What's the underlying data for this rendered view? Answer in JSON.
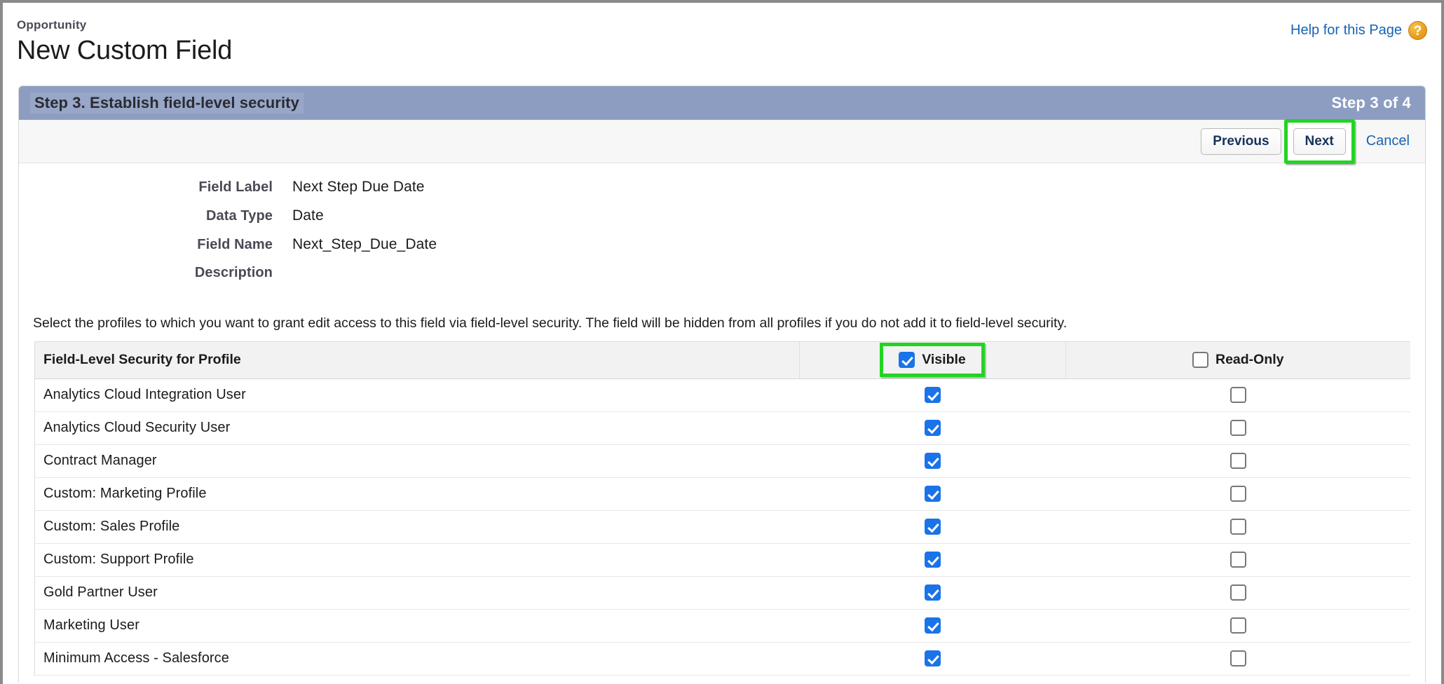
{
  "header": {
    "object": "Opportunity",
    "title": "New Custom Field",
    "help_label": "Help for this Page",
    "help_icon": "question-mark-badge-icon"
  },
  "step_bar": {
    "title": "Step 3. Establish field-level security",
    "count": "Step 3 of 4",
    "color": "#8d9dc2"
  },
  "buttons": {
    "previous": "Previous",
    "next": "Next",
    "cancel": "Cancel",
    "highlight_color": "#22d422"
  },
  "summary": [
    {
      "label": "Field Label",
      "value": "Next Step Due Date"
    },
    {
      "label": "Data Type",
      "value": "Date"
    },
    {
      "label": "Field Name",
      "value": "Next_Step_Due_Date"
    },
    {
      "label": "Description",
      "value": ""
    }
  ],
  "instruction": "Select the profiles to which you want to grant edit access to this field via field-level security. The field will be hidden from all profiles if you do not add it to field-level security.",
  "table": {
    "columns": {
      "profile": "Field-Level Security for Profile",
      "visible": "Visible",
      "readonly": "Read-Only"
    },
    "header_checkboxes": {
      "visible_checked": true,
      "readonly_checked": false
    },
    "accent_checked_color": "#1a73e8",
    "rows": [
      {
        "profile": "Analytics Cloud Integration User",
        "visible": true,
        "readonly": false
      },
      {
        "profile": "Analytics Cloud Security User",
        "visible": true,
        "readonly": false
      },
      {
        "profile": "Contract Manager",
        "visible": true,
        "readonly": false
      },
      {
        "profile": "Custom: Marketing Profile",
        "visible": true,
        "readonly": false
      },
      {
        "profile": "Custom: Sales Profile",
        "visible": true,
        "readonly": false
      },
      {
        "profile": "Custom: Support Profile",
        "visible": true,
        "readonly": false
      },
      {
        "profile": "Gold Partner User",
        "visible": true,
        "readonly": false
      },
      {
        "profile": "Marketing User",
        "visible": true,
        "readonly": false
      },
      {
        "profile": "Minimum Access - Salesforce",
        "visible": true,
        "readonly": false
      }
    ]
  }
}
